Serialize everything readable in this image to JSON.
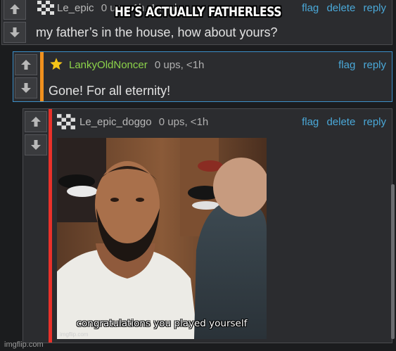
{
  "caption": "HE’S ACTUALLY FATHERLESS",
  "watermark": "imgflip.com",
  "comments": [
    {
      "username": "Le_epic",
      "stats": "0 ups, 1h, 1 reply",
      "actions": [
        "flag",
        "delete",
        "reply"
      ],
      "text": "my father’s in the house, how about yours?",
      "avatar_icon": "pixel-avatar-icon",
      "bar_color": ""
    },
    {
      "username": "LankyOldNoncer",
      "stats": "0 ups, <1h",
      "actions": [
        "flag",
        "reply"
      ],
      "text": "Gone! For all eternity!",
      "avatar_icon": "star-icon",
      "bar_color": "#f0901e"
    },
    {
      "username": "Le_epic_doggo",
      "stats": "0 ups, <1h",
      "actions": [
        "flag",
        "delete",
        "reply"
      ],
      "image_caption": "congratulations you played yourself",
      "image_watermark": "imgflip.com",
      "avatar_icon": "pixel-avatar-icon",
      "bar_color": "#e8312a"
    }
  ],
  "colors": {
    "link": "#4aa8d8",
    "background": "#1b1c1e",
    "panel": "#2b2c2f"
  }
}
